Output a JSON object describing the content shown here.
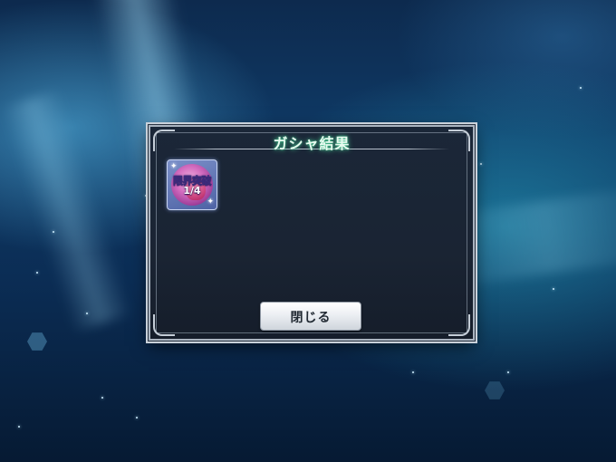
{
  "dialog": {
    "title": "ガシャ結果"
  },
  "results": [
    {
      "icon": "limit-break-item-icon",
      "label": "限界突破",
      "count": "1/4"
    }
  ],
  "buttons": {
    "close_label": "閉じる"
  },
  "colors": {
    "title_glow": "#5ae6aa",
    "dialog_bg": "#1b2738",
    "item_card_bg": "#4e63a5"
  }
}
